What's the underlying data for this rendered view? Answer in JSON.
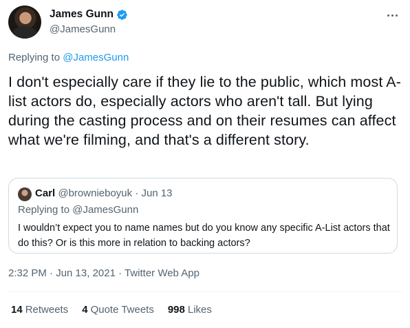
{
  "author": {
    "name": "James Gunn",
    "handle": "@JamesGunn",
    "verified_icon": "verified-badge-icon",
    "accent": "#1d9bf0"
  },
  "replying": {
    "prefix": "Replying to ",
    "handle": "@JamesGunn"
  },
  "tweet_text": "I don't especially care if they lie to the public, which most A-list actors do, especially actors who aren't tall. But lying during the casting process and on their resumes can affect what we're filming, and that's a different story.",
  "quote": {
    "name": "Carl",
    "handle": "@brownieboyuk",
    "date": " · Jun 13",
    "replying_prefix": "Replying to ",
    "replying_handle": "@JamesGunn",
    "text": "I wouldn’t expect you to name names but do you know any specific A-List actors that do this? Or is this more in relation to backing actors?"
  },
  "timestamp": "2:32 PM · Jun 13, 2021 · Twitter Web App",
  "stats": [
    {
      "count": "14",
      "label": "Retweets"
    },
    {
      "count": "4",
      "label": "Quote Tweets"
    },
    {
      "count": "998",
      "label": "Likes"
    }
  ]
}
